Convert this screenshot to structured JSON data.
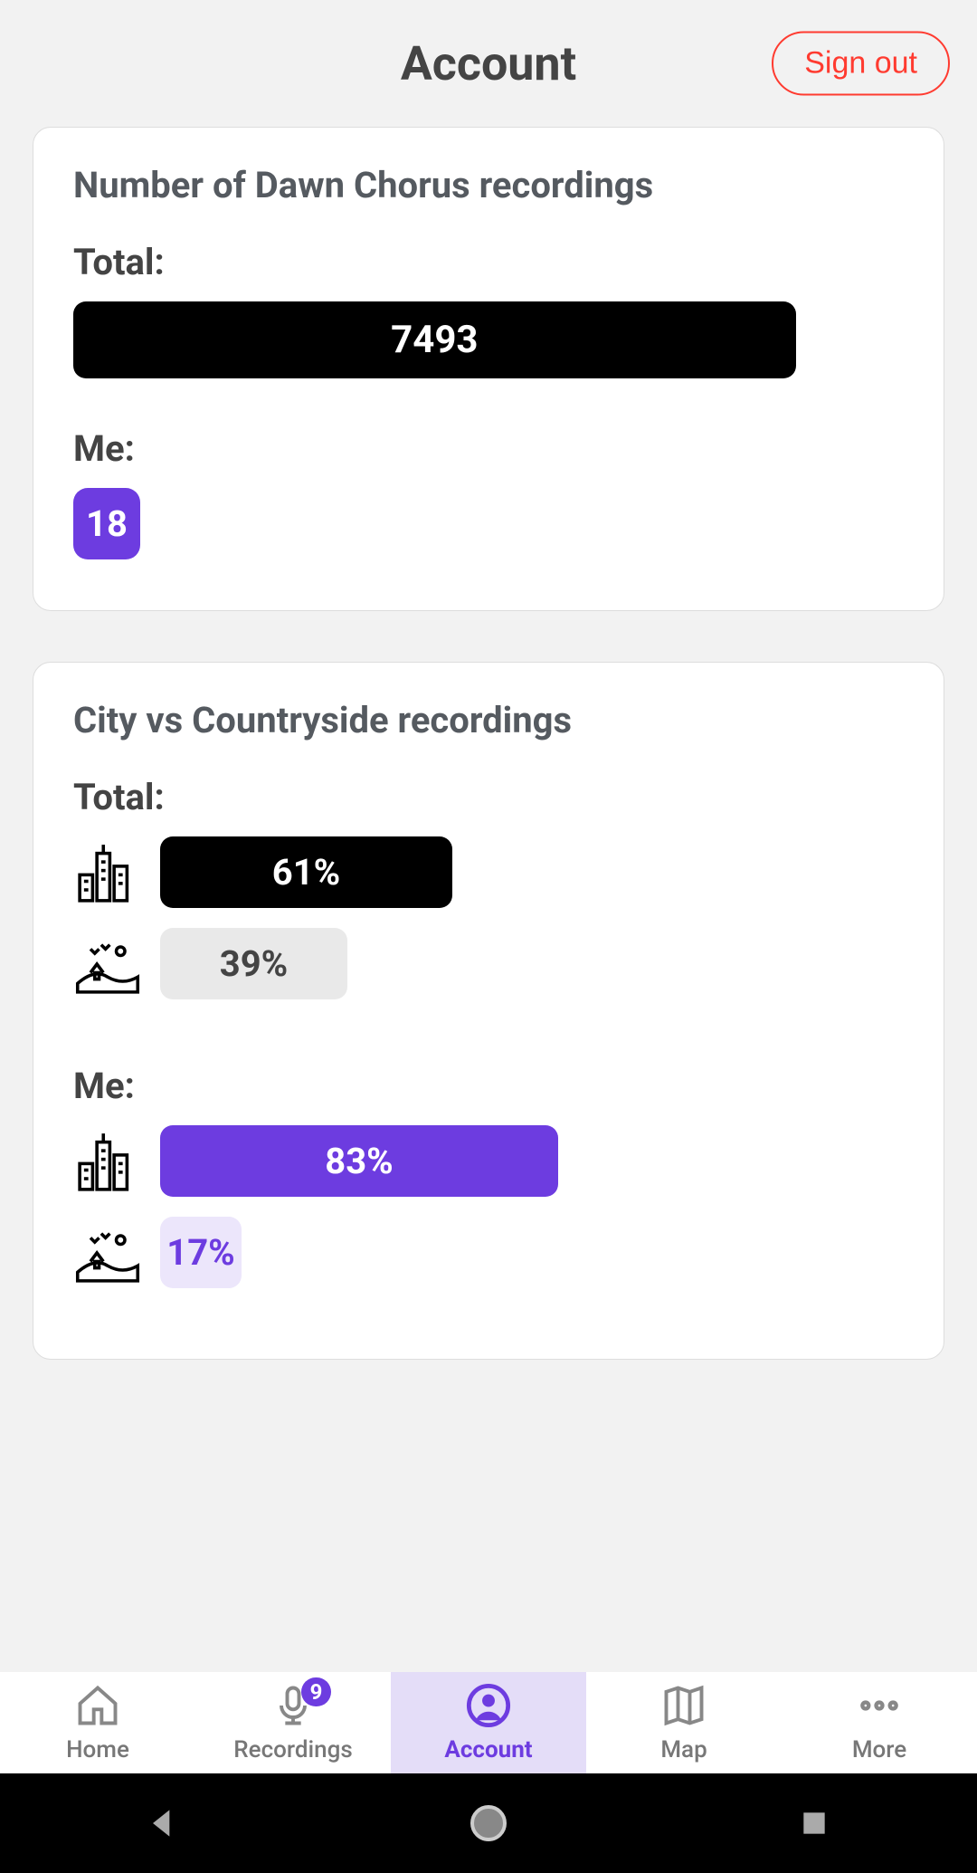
{
  "header": {
    "title": "Account",
    "sign_out": "Sign out"
  },
  "card1": {
    "title": "Number of Dawn Chorus recordings",
    "total_label": "Total:",
    "total_value": "7493",
    "me_label": "Me:",
    "me_value": "18"
  },
  "card2": {
    "title": "City vs Countryside recordings",
    "total_label": "Total:",
    "total_city_pct": 61,
    "total_city_text": "61%",
    "total_country_pct": 39,
    "total_country_text": "39%",
    "me_label": "Me:",
    "me_city_pct": 83,
    "me_city_text": "83%",
    "me_country_pct": 17,
    "me_country_text": "17%"
  },
  "tabs": {
    "home": "Home",
    "recordings": "Recordings",
    "recordings_badge": "9",
    "account": "Account",
    "map": "Map",
    "more": "More"
  },
  "chart_data": [
    {
      "type": "bar",
      "title": "Number of Dawn Chorus recordings",
      "categories": [
        "Total",
        "Me"
      ],
      "values": [
        7493,
        18
      ],
      "xlabel": "",
      "ylabel": "",
      "ylim": [
        0,
        8000
      ]
    },
    {
      "type": "bar",
      "title": "City vs Countryside recordings",
      "categories": [
        "City",
        "Countryside"
      ],
      "series": [
        {
          "name": "Total",
          "values": [
            61,
            39
          ]
        },
        {
          "name": "Me",
          "values": [
            83,
            17
          ]
        }
      ],
      "xlabel": "",
      "ylabel": "Percent",
      "ylim": [
        0,
        100
      ]
    }
  ]
}
